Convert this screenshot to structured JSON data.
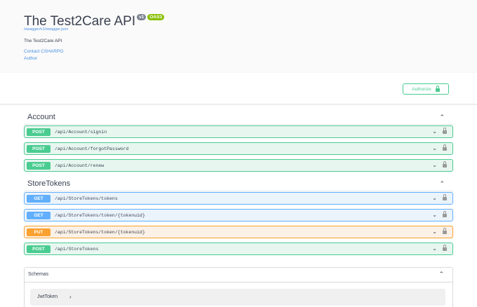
{
  "info": {
    "title": "The Test2Care API",
    "version_badge": "v1",
    "oas_badge": "OAS3",
    "spec_url": "/swagger/v1/swagger.json",
    "description": "The Test2Care API",
    "contact": "Contact CSHARPO",
    "author": "Author"
  },
  "auth": {
    "label": "Authorize"
  },
  "tags": [
    {
      "name": "Account",
      "ops": [
        {
          "method": "POST",
          "path": "/api/Account/signin"
        },
        {
          "method": "POST",
          "path": "/api/Account/forgotPassword"
        },
        {
          "method": "POST",
          "path": "/api/Account/renew"
        }
      ]
    },
    {
      "name": "StoreTokens",
      "ops": [
        {
          "method": "GET",
          "path": "/api/StoreTokens/tokens"
        },
        {
          "method": "GET",
          "path": "/api/StoreTokens/token/{tokenuid}"
        },
        {
          "method": "PUT",
          "path": "/api/StoreTokens/token/{tokenuid}"
        },
        {
          "method": "POST",
          "path": "/api/StoreTokens"
        }
      ]
    }
  ],
  "schemas": {
    "title": "Schemas",
    "models": [
      {
        "name": "JwtToken"
      }
    ]
  },
  "icons": {
    "collapse": "chevron-up-icon",
    "expand": "chevron-down-icon",
    "lock": "lock-icon",
    "model_expand": "chevron-right-icon"
  },
  "colors": {
    "post": "#49cc90",
    "get": "#61affe",
    "put": "#fca130",
    "link": "#4990e2"
  }
}
